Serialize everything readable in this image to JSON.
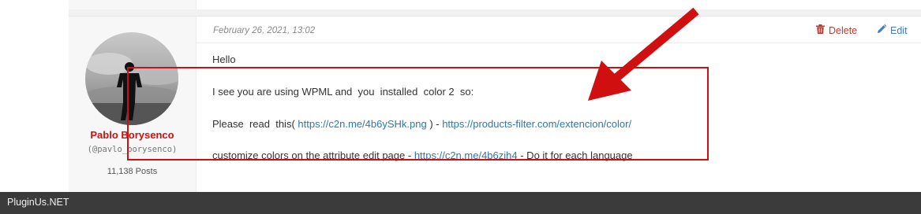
{
  "post": {
    "author": {
      "name": "Pablo Borysenco",
      "handle": "(@pavlo_borysenco)",
      "posts": "11,138 Posts"
    },
    "date": "February 26, 2021, 13:02",
    "actions": {
      "delete_label": "Delete",
      "edit_label": "Edit"
    },
    "body": {
      "greeting": "Hello",
      "line1": "I see you are using WPML and  you  installed  color 2  so:",
      "line2_prefix": "Please  read  this( ",
      "line2_link1": "https://c2n.me/4b6ySHk.png",
      "line2_middle": " ) - ",
      "line2_link2": "https://products-filter.com/extencion/color/",
      "line3_prefix": "customize colors on the attribute edit page - ",
      "line3_link": "https://c2n.me/4b6zih4",
      "line3_suffix": " - Do it for each language"
    }
  },
  "footer": {
    "label": "PluginUs.NET"
  },
  "colors": {
    "author_name": "#cc1111",
    "delete": "#c0392b",
    "edit": "#3a7dc9",
    "link": "#2a78b8",
    "annotation": "#d01010",
    "footer_bg": "#3b3b3b"
  },
  "icons": {
    "delete": "trash-icon",
    "edit": "pencil-icon",
    "annotation": "arrow-icon"
  }
}
